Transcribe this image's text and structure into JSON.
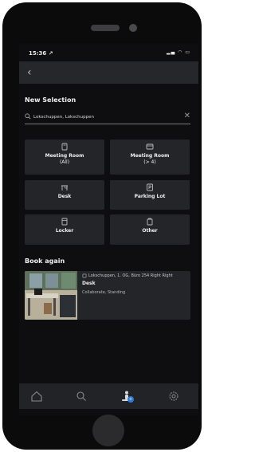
{
  "status": {
    "time": "15:36 ↗",
    "indicators": "▂▄ ◠ ▭"
  },
  "nav": {
    "back_icon": "‹"
  },
  "new_selection": {
    "title": "New Selection",
    "search": {
      "value": "Lokschuppen, Lokschuppen",
      "clear_icon": "✕"
    },
    "tiles": [
      {
        "label": "Meeting Room",
        "sub": "(All)",
        "icon": "meeting-room-icon"
      },
      {
        "label": "Meeting Room",
        "sub": "(> 4)",
        "icon": "meeting-room-large-icon"
      },
      {
        "label": "Desk",
        "sub": "",
        "icon": "desk-icon"
      },
      {
        "label": "Parking Lot",
        "sub": "",
        "icon": "parking-icon"
      },
      {
        "label": "Locker",
        "sub": "",
        "icon": "locker-icon"
      },
      {
        "label": "Other",
        "sub": "",
        "icon": "other-icon"
      }
    ]
  },
  "book_again": {
    "title": "Book again",
    "card": {
      "location": "Lokschuppen, 1. OG, Büro 254 Right Right",
      "type": "Desk",
      "tags": "Collaborate, Standing"
    }
  },
  "tabbar": {
    "items": [
      "home-icon",
      "search-icon",
      "booking-person-icon",
      "settings-icon"
    ],
    "badge": "+"
  },
  "colors": {
    "screen_bg": "#0e0e10",
    "tile_bg": "#232529",
    "accent": "#2f7bd6"
  }
}
